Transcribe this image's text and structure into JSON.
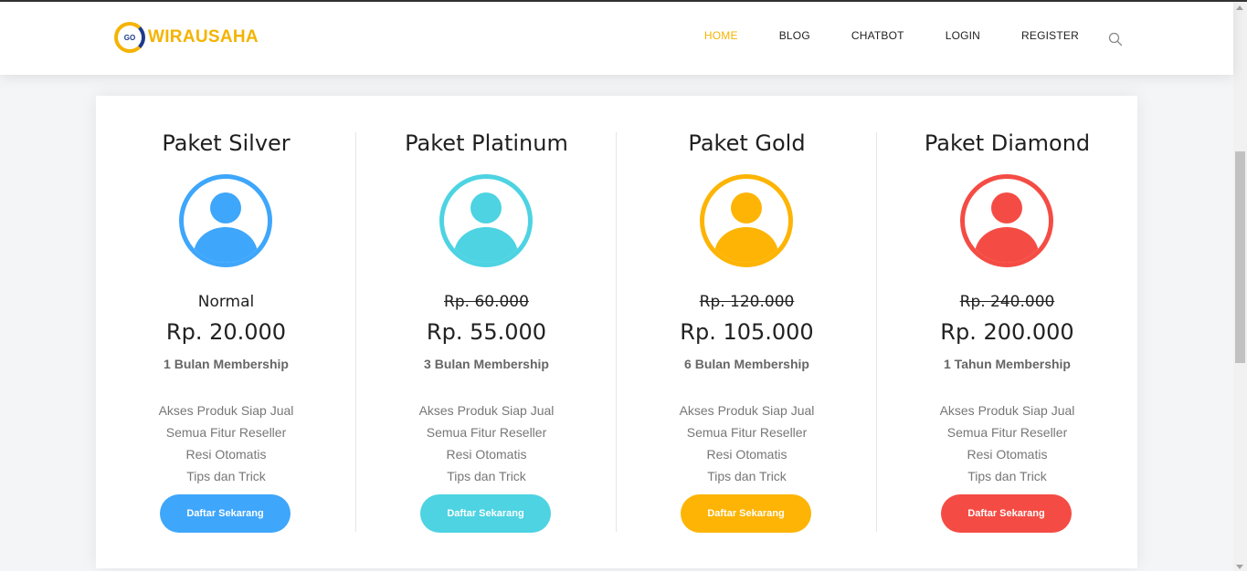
{
  "brand": {
    "badge": "GO",
    "name": "WIRAUSAHA"
  },
  "nav": {
    "items": [
      {
        "label": "HOME",
        "active": true
      },
      {
        "label": "BLOG"
      },
      {
        "label": "CHATBOT"
      },
      {
        "label": "LOGIN"
      },
      {
        "label": "REGISTER"
      }
    ],
    "search_icon": "search-icon"
  },
  "colors": {
    "accent": "#f5b301",
    "silver": "#3ea6fb",
    "platinum": "#4dd3e2",
    "gold": "#fdb404",
    "diamond": "#f44c44"
  },
  "plans": [
    {
      "title": "Paket Silver",
      "price_old": "Normal",
      "price_new": "Rp. 20.000",
      "duration": "1 Bulan Membership",
      "features": [
        "Akses Produk Siap Jual",
        "Semua Fitur Reseller",
        "Resi Otomatis",
        "Tips dan Trick"
      ],
      "cta": "Daftar Sekarang",
      "avatar_icon": "user-icon"
    },
    {
      "title": "Paket Platinum",
      "price_old": "Rp. 60.000",
      "price_new": "Rp. 55.000",
      "duration": "3 Bulan Membership",
      "features": [
        "Akses Produk Siap Jual",
        "Semua Fitur Reseller",
        "Resi Otomatis",
        "Tips dan Trick"
      ],
      "cta": "Daftar Sekarang",
      "avatar_icon": "user-icon"
    },
    {
      "title": "Paket Gold",
      "price_old": "Rp. 120.000",
      "price_new": "Rp. 105.000",
      "duration": "6 Bulan Membership",
      "features": [
        "Akses Produk Siap Jual",
        "Semua Fitur Reseller",
        "Resi Otomatis",
        "Tips dan Trick"
      ],
      "cta": "Daftar Sekarang",
      "avatar_icon": "user-icon"
    },
    {
      "title": "Paket Diamond",
      "price_old": "Rp. 240.000",
      "price_new": "Rp. 200.000",
      "duration": "1 Tahun Membership",
      "features": [
        "Akses Produk Siap Jual",
        "Semua Fitur Reseller",
        "Resi Otomatis",
        "Tips dan Trick"
      ],
      "cta": "Daftar Sekarang",
      "avatar_icon": "user-icon"
    }
  ]
}
